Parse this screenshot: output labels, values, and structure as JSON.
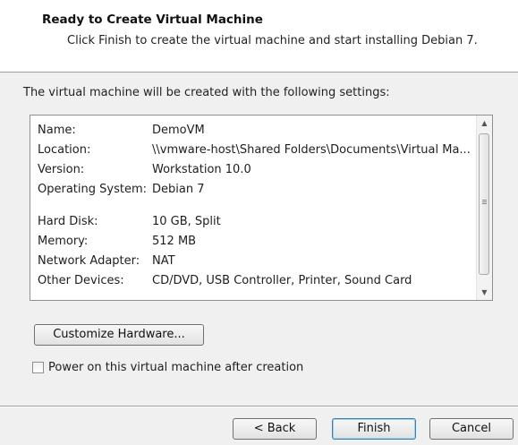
{
  "header": {
    "title": "Ready to Create Virtual Machine",
    "subtitle": "Click Finish to create the virtual machine and start installing Debian 7."
  },
  "intro": "The virtual machine will be created with the following settings:",
  "settings": [
    {
      "label": "Name:",
      "value": "DemoVM"
    },
    {
      "label": "Location:",
      "value": "\\\\vmware-host\\Shared Folders\\Documents\\Virtual Ma..."
    },
    {
      "label": "Version:",
      "value": "Workstation 10.0"
    },
    {
      "label": "Operating System:",
      "value": "Debian 7"
    },
    {
      "label": "",
      "value": ""
    },
    {
      "label": "Hard Disk:",
      "value": "10 GB, Split"
    },
    {
      "label": "Memory:",
      "value": "512 MB"
    },
    {
      "label": "Network Adapter:",
      "value": "NAT"
    },
    {
      "label": "Other Devices:",
      "value": "CD/DVD, USB Controller, Printer, Sound Card"
    }
  ],
  "customize_button": "Customize Hardware...",
  "power_on": {
    "label": "Power on this virtual machine after creation",
    "checked": false
  },
  "footer": {
    "back": "< Back",
    "finish": "Finish",
    "cancel": "Cancel"
  }
}
